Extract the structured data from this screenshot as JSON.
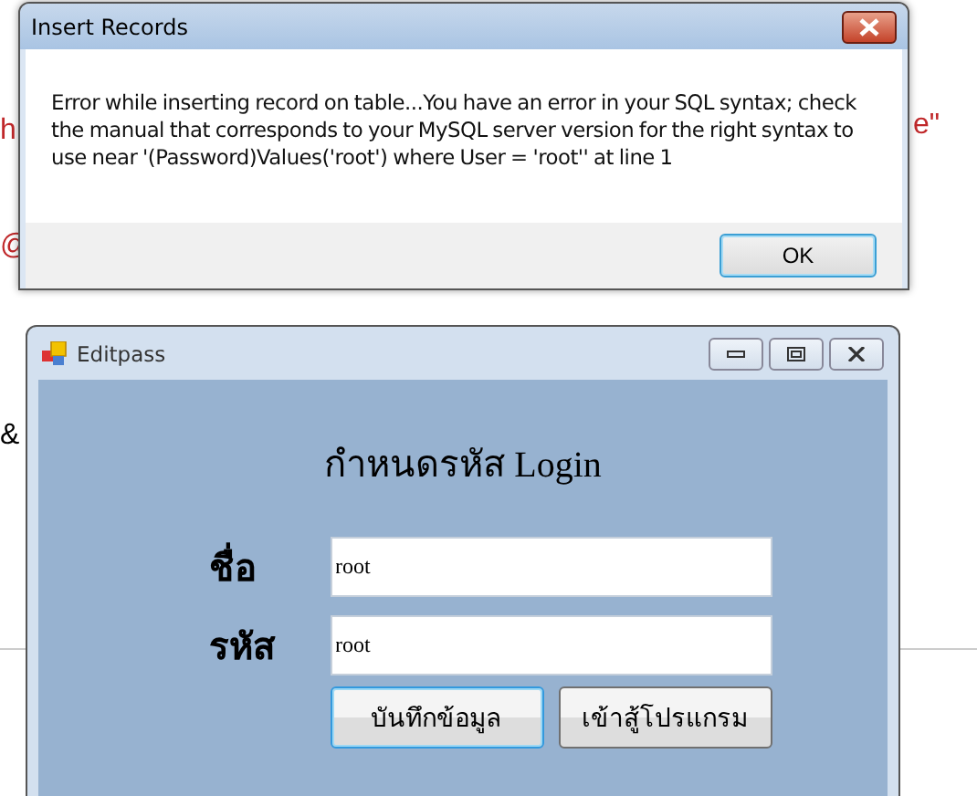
{
  "background": {
    "fragments": [
      "h",
      "e\"",
      "@",
      "&"
    ]
  },
  "dialog": {
    "title": "Insert Records",
    "message": "Error while inserting record on table...You have an error in your SQL syntax; check the manual that corresponds to your MySQL server version for the right syntax to use near '(Password)Values('root') where User = 'root'' at line 1",
    "buttons": [
      {
        "label": "OK",
        "selected": true
      }
    ]
  },
  "window": {
    "title": "Editpass",
    "heading": "กำหนดรหัส Login",
    "fields": [
      {
        "label": "ชื่อ",
        "value": "root"
      },
      {
        "label": "รหัส",
        "value": "root"
      }
    ],
    "buttons": [
      {
        "label": "บันทึกข้อมูล",
        "selected": true
      },
      {
        "label": "เข้าสู้โปรแกรม",
        "selected": false
      }
    ]
  }
}
